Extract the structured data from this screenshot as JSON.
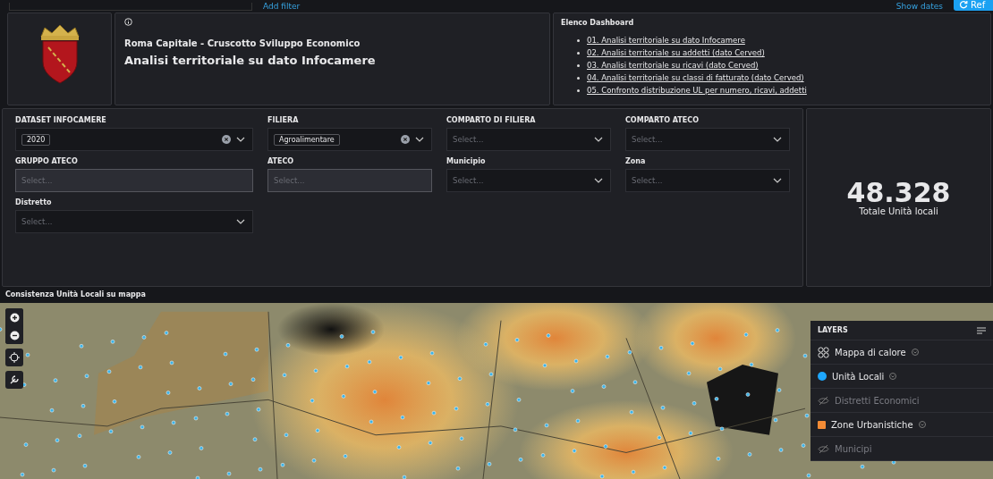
{
  "top_bar": {
    "add_filter": "Add filter",
    "show_dates": "Show dates",
    "refresh_button": "Ref"
  },
  "title_panel": {
    "subtitle": "Roma Capitale - Cruscotto Sviluppo Economico",
    "title": "Analisi territoriale su dato Infocamere"
  },
  "dashboard_list": {
    "title": "Elenco Dashboard",
    "links": [
      "01. Analisi territoriale su dato Infocamere",
      "02. Analisi territoriale su addetti (dato Cerved)",
      "03. Analisi territoriale su ricavi (dato Cerved)",
      "04. Analisi territoriale su classi di fatturato (dato Cerved)",
      "05. Confronto distribuzione UL per numero, ricavi, addetti"
    ]
  },
  "filters": [
    {
      "label": "DATASET INFOCAMERE",
      "value": "2020",
      "dropdown": true
    },
    {
      "label": "FILIERA",
      "value": "Agroalimentare",
      "dropdown": true
    },
    {
      "label": "COMPARTO DI FILIERA",
      "placeholder": "Select...",
      "dropdown": true
    },
    {
      "label": "COMPARTO ATECO",
      "placeholder": "Select...",
      "dropdown": true
    },
    {
      "label": "GRUPPO ATECO",
      "placeholder": "Select...",
      "dropdown": false
    },
    {
      "label": "ATECO",
      "placeholder": "Select...",
      "dropdown": false
    },
    {
      "label": "Municipio",
      "placeholder": "Select...",
      "dropdown": true
    },
    {
      "label": "Zona",
      "placeholder": "Select...",
      "dropdown": true
    },
    {
      "label": "Distretto",
      "placeholder": "Select...",
      "dropdown": true
    }
  ],
  "kpi": {
    "value": "48.328",
    "label": "Totale Unità locali"
  },
  "map": {
    "title": "Consistenza Unità Locali su mappa",
    "layers_title": "LAYERS",
    "layers": [
      {
        "name": "Mappa di calore",
        "kind": "heatmap",
        "visible": true
      },
      {
        "name": "Unità Locali",
        "kind": "points",
        "visible": true,
        "color": "#1ea7fd"
      },
      {
        "name": "Distretti Economici",
        "visible": false
      },
      {
        "name": "Zone Urbanistiche",
        "kind": "polygons",
        "visible": true,
        "color": "#f38b35"
      },
      {
        "name": "Municipi",
        "visible": false
      }
    ]
  }
}
